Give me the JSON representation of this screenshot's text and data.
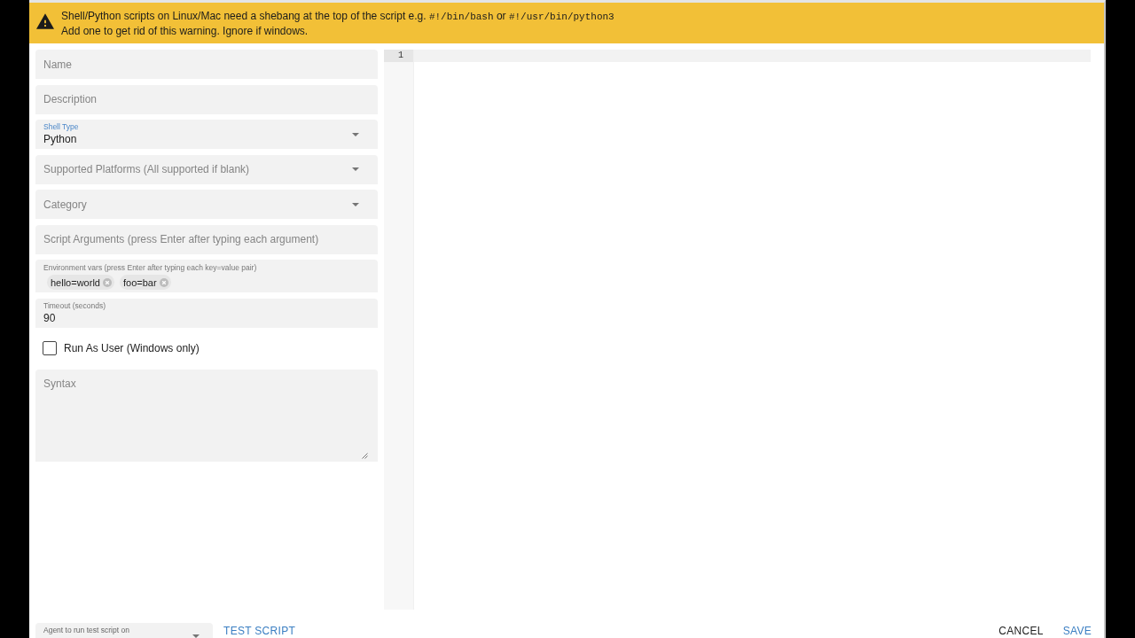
{
  "warning_banner": {
    "lines": [
      [
        {
          "kind": "text",
          "text": "Shell/Python scripts on Linux/Mac need a shebang at the top of the script e.g. "
        },
        {
          "kind": "code",
          "text": "#!/bin/bash"
        },
        {
          "kind": "text",
          "text": " or "
        },
        {
          "kind": "code",
          "text": "#!/usr/bin/python3"
        }
      ],
      [
        {
          "kind": "text",
          "text": "Add one to get rid of this warning. Ignore if windows."
        }
      ]
    ]
  },
  "form": {
    "fields": [
      {
        "kind": "text",
        "placeholder": "Name",
        "focused": false
      },
      {
        "kind": "text",
        "placeholder": "Description",
        "focused": false
      },
      {
        "kind": "select",
        "label": "Shell Type",
        "value": "Python",
        "focused": true
      },
      {
        "kind": "select",
        "placeholder": "Supported Platforms (All supported if blank)",
        "focused": false
      },
      {
        "kind": "select",
        "placeholder": "Category",
        "focused": false
      },
      {
        "kind": "text",
        "placeholder": "Script Arguments (press Enter after typing each argument)",
        "focused": false
      },
      {
        "kind": "chips",
        "label": "Environment vars (press Enter after typing each key=value pair)",
        "chips": [
          "hello=world",
          "foo=bar"
        ],
        "focused": false
      },
      {
        "kind": "text",
        "label": "Timeout (seconds)",
        "value": "90",
        "focused": false
      },
      {
        "kind": "checkbox",
        "label": "Run As User (Windows only)",
        "checked": false
      },
      {
        "kind": "textarea",
        "placeholder": "Syntax",
        "focused": false
      }
    ]
  },
  "editor": {
    "lines": [
      {
        "number": "1",
        "active": true
      }
    ]
  },
  "footer": {
    "agent_select": {
      "label": "Agent to run test script on"
    },
    "buttons": [
      {
        "kind": "test",
        "label": "TEST SCRIPT"
      },
      {
        "kind": "cancel",
        "label": "CANCEL"
      },
      {
        "kind": "save",
        "label": "SAVE"
      }
    ]
  }
}
